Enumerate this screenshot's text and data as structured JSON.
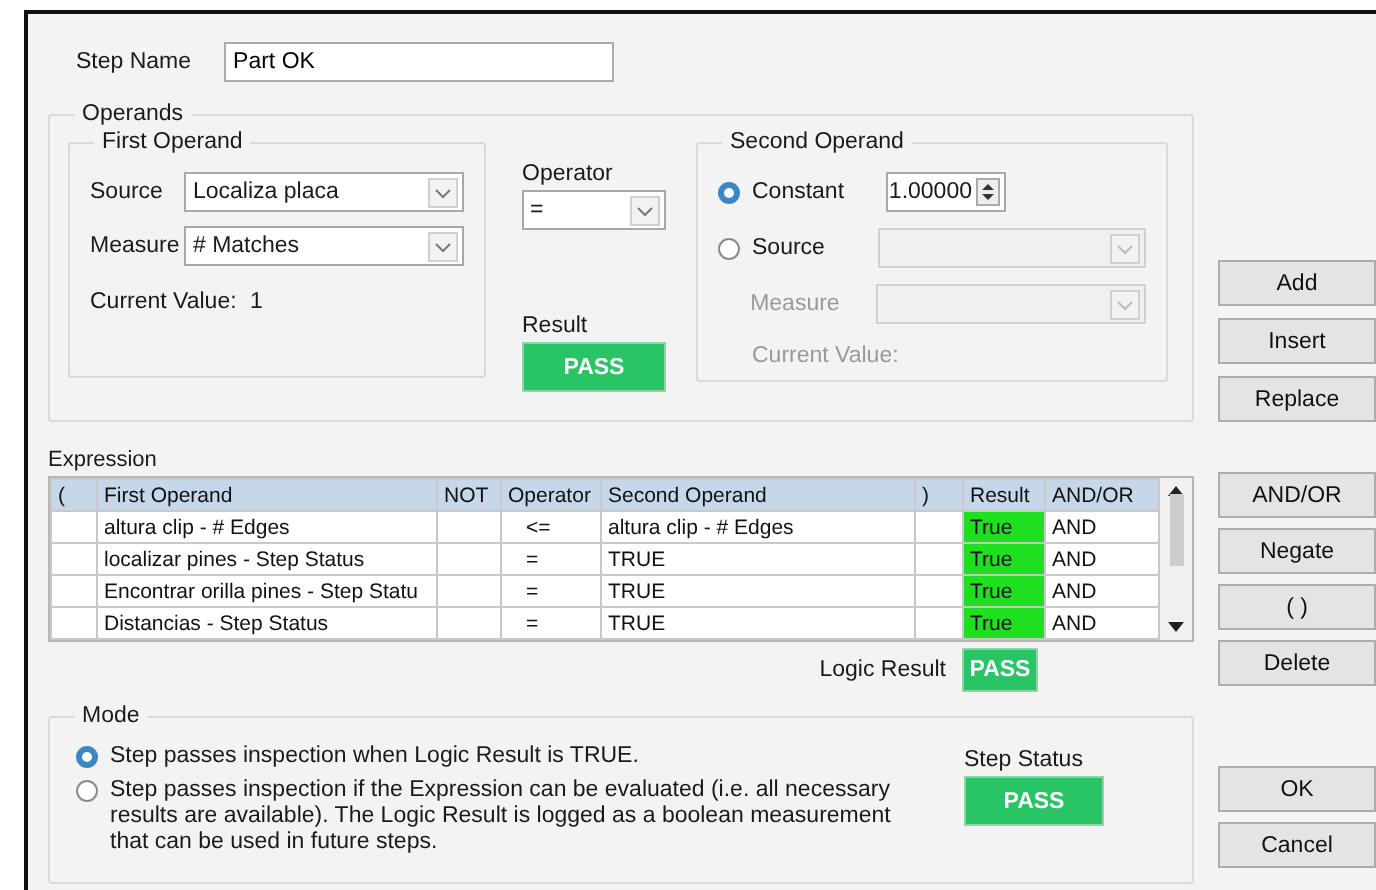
{
  "step_name": {
    "label": "Step Name",
    "value": "Part OK"
  },
  "operands": {
    "title": "Operands",
    "first_operand": {
      "title": "First Operand",
      "fields": [
        {
          "label": "Source",
          "value": "Localiza placa"
        },
        {
          "label": "Measure",
          "value": "# Matches"
        }
      ],
      "current_value": {
        "label": "Current Value:",
        "value": "1"
      }
    },
    "operator": {
      "label": "Operator",
      "value": "="
    },
    "result": {
      "label": "Result",
      "value": "PASS"
    },
    "second_operand": {
      "title": "Second Operand",
      "options": [
        {
          "label": "Constant",
          "selected": true,
          "kind": "spin",
          "value": "1.00000"
        },
        {
          "label": "Source",
          "selected": false,
          "kind": "select"
        }
      ],
      "measure": {
        "label": "Measure",
        "disabled": true
      },
      "current_value": {
        "label": "Current Value:",
        "disabled": true
      }
    }
  },
  "expression": {
    "title": "Expression",
    "columns": [
      "(",
      "First Operand",
      "NOT",
      "Operator",
      "Second Operand",
      ")",
      "Result",
      "AND/OR"
    ],
    "rows": [
      {
        "first_operand": "altura clip - # Edges",
        "operator": "<=",
        "second_operand": "altura clip - # Edges",
        "result": "True",
        "and_or": "AND"
      },
      {
        "first_operand": "localizar pines - Step Status",
        "operator": "=",
        "second_operand": "TRUE",
        "result": "True",
        "and_or": "AND"
      },
      {
        "first_operand": "Encontrar orilla pines - Step Statu",
        "operator": "=",
        "second_operand": "TRUE",
        "result": "True",
        "and_or": "AND"
      },
      {
        "first_operand": "Distancias - Step Status",
        "operator": "=",
        "second_operand": "TRUE",
        "result": "True",
        "and_or": "AND"
      }
    ]
  },
  "logic_result": {
    "label": "Logic Result",
    "value": "PASS"
  },
  "mode": {
    "title": "Mode",
    "options": [
      {
        "label": "Step passes inspection when Logic Result is TRUE.",
        "selected": true
      },
      {
        "label": "Step passes inspection if the Expression can be evaluated (i.e. all necessary results are available). The Logic Result is logged as a boolean measurement that can be used in future steps.",
        "selected": false
      }
    ],
    "step_status": {
      "label": "Step Status",
      "value": "PASS"
    }
  },
  "buttons": {
    "operand_actions": [
      "Add",
      "Insert",
      "Replace"
    ],
    "expression_actions": [
      "AND/OR",
      "Negate",
      "( )",
      "Delete"
    ],
    "dialog_actions": [
      "OK",
      "Cancel"
    ]
  }
}
